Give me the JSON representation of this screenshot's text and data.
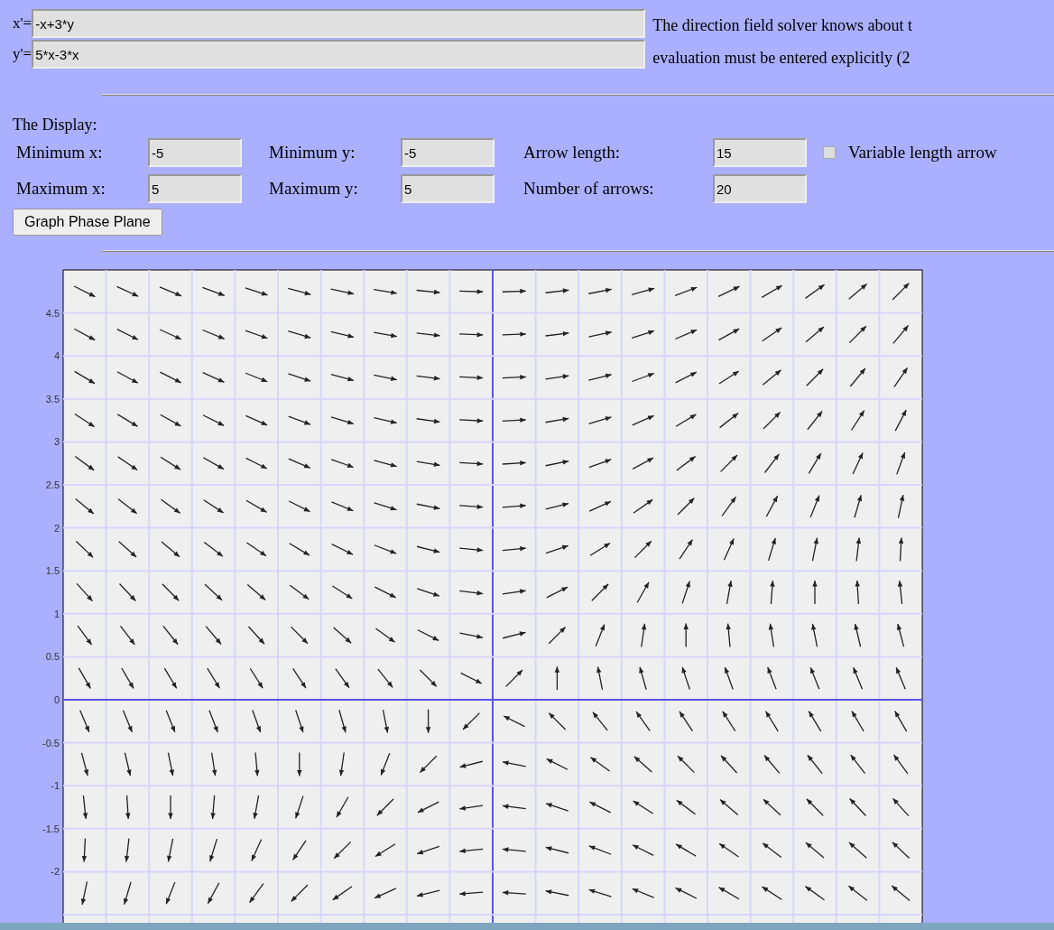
{
  "equations": [
    {
      "label": "x'=",
      "value": "-x+3*y"
    },
    {
      "label": "y'=",
      "value": "5*x-3*x"
    }
  ],
  "help_text": [
    "The direction field solver knows about t",
    "evaluation must be entered explicitly (2"
  ],
  "display": {
    "heading": "The Display:",
    "fields": [
      {
        "label": "Minimum x:",
        "value": "-5"
      },
      {
        "label": "Minimum y:",
        "value": "-5"
      },
      {
        "label": "Arrow length:",
        "value": "15"
      },
      {
        "label": "Maximum x:",
        "value": "5"
      },
      {
        "label": "Maximum y:",
        "value": "5"
      },
      {
        "label": "Number of arrows:",
        "value": "20"
      }
    ],
    "variable_length": {
      "label": "Variable length arrow",
      "checked": false
    },
    "button": "Graph Phase Plane"
  },
  "plot": {
    "y_tick_labels": [
      "4.5",
      "4",
      "3.5",
      "3",
      "2.5",
      "2",
      "1.5",
      "1",
      "0.5",
      "0",
      "-0.5",
      "-1",
      "-1.5",
      "-2"
    ]
  }
}
